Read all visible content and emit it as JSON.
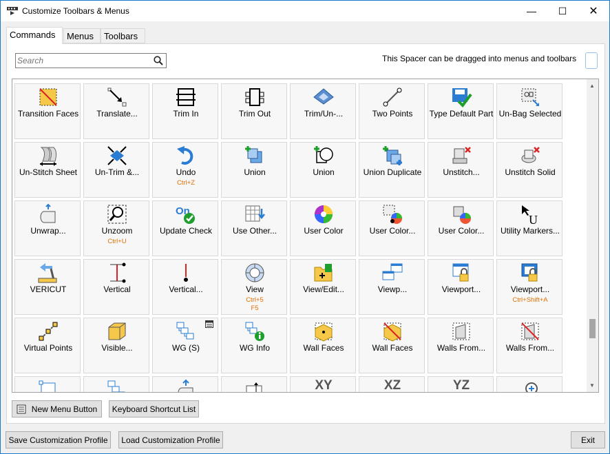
{
  "window": {
    "title": "Customize Toolbars & Menus"
  },
  "tabs": [
    "Commands",
    "Menus",
    "Toolbars"
  ],
  "search": {
    "placeholder": "Search"
  },
  "spacer": {
    "text": "This Spacer can be dragged into menus and toolbars"
  },
  "rows": [
    [
      {
        "label": "Transition Faces",
        "shortcut": "",
        "icon": "transition-faces"
      },
      {
        "label": "Translate...",
        "shortcut": "",
        "icon": "translate"
      },
      {
        "label": "Trim In",
        "shortcut": "",
        "icon": "trim-in"
      },
      {
        "label": "Trim Out",
        "shortcut": "",
        "icon": "trim-out"
      },
      {
        "label": "Trim/Un-...",
        "shortcut": "",
        "icon": "trim-untrim"
      },
      {
        "label": "Two Points",
        "shortcut": "",
        "icon": "two-points"
      },
      {
        "label": "Type Default Part",
        "shortcut": "",
        "icon": "type-default-part"
      },
      {
        "label": "Un-Bag Selected",
        "shortcut": "",
        "icon": "un-bag"
      }
    ],
    [
      {
        "label": "Un-Stitch Sheet",
        "shortcut": "",
        "icon": "unstitch-sheet"
      },
      {
        "label": "Un-Trim &...",
        "shortcut": "",
        "icon": "untrim"
      },
      {
        "label": "Undo",
        "shortcut": "Ctrl+Z",
        "icon": "undo"
      },
      {
        "label": "Union",
        "shortcut": "",
        "icon": "union-box"
      },
      {
        "label": "Union",
        "shortcut": "",
        "icon": "union-2d"
      },
      {
        "label": "Union Duplicate",
        "shortcut": "",
        "icon": "union-duplicate"
      },
      {
        "label": "Unstitch...",
        "shortcut": "",
        "icon": "unstitch"
      },
      {
        "label": "Unstitch Solid",
        "shortcut": "",
        "icon": "unstitch-solid"
      }
    ],
    [
      {
        "label": "Unwrap...",
        "shortcut": "",
        "icon": "unwrap"
      },
      {
        "label": "Unzoom",
        "shortcut": "Ctrl+U",
        "icon": "unzoom"
      },
      {
        "label": "Update Check",
        "shortcut": "",
        "icon": "update-check"
      },
      {
        "label": "Use Other...",
        "shortcut": "",
        "icon": "use-other"
      },
      {
        "label": "User Color",
        "shortcut": "",
        "icon": "user-color"
      },
      {
        "label": "User Color...",
        "shortcut": "",
        "icon": "user-color-sel"
      },
      {
        "label": "User Color...",
        "shortcut": "",
        "icon": "user-color-solid"
      },
      {
        "label": "Utility Markers...",
        "shortcut": "",
        "icon": "utility-markers"
      }
    ],
    [
      {
        "label": "VERICUT",
        "shortcut": "",
        "icon": "vericut"
      },
      {
        "label": "Vertical",
        "shortcut": "",
        "icon": "vertical"
      },
      {
        "label": "Vertical...",
        "shortcut": "",
        "icon": "vertical-line"
      },
      {
        "label": "View",
        "shortcut": "Ctrl+5",
        "shortcut2": "F5",
        "icon": "view"
      },
      {
        "label": "View/Edit...",
        "shortcut": "",
        "icon": "view-edit"
      },
      {
        "label": "Viewp...",
        "shortcut": "",
        "icon": "viewports"
      },
      {
        "label": "Viewport...",
        "shortcut": "",
        "icon": "viewport-lock"
      },
      {
        "label": "Viewport...",
        "shortcut": "Ctrl+Shift+A",
        "icon": "viewport-lock-blue"
      }
    ],
    [
      {
        "label": "Virtual Points",
        "shortcut": "",
        "icon": "virtual-points"
      },
      {
        "label": "Visible...",
        "shortcut": "",
        "icon": "visible"
      },
      {
        "label": "WG (S)",
        "shortcut": "",
        "icon": "wg",
        "badge": true
      },
      {
        "label": "WG Info",
        "shortcut": "",
        "icon": "wg-info"
      },
      {
        "label": "Wall Faces",
        "shortcut": "",
        "icon": "wall-faces"
      },
      {
        "label": "Wall Faces",
        "shortcut": "",
        "icon": "wall-faces-x"
      },
      {
        "label": "Walls From...",
        "shortcut": "",
        "icon": "walls-from"
      },
      {
        "label": "Walls From...",
        "shortcut": "",
        "icon": "walls-from-x"
      }
    ],
    [
      {
        "label": "",
        "shortcut": "",
        "icon": "row6-a"
      },
      {
        "label": "",
        "shortcut": "",
        "icon": "row6-b"
      },
      {
        "label": "",
        "shortcut": "",
        "icon": "row6-c"
      },
      {
        "label": "",
        "shortcut": "",
        "icon": "row6-d"
      },
      {
        "label": "",
        "shortcut": "",
        "icon": "xy",
        "bigtext": "XY"
      },
      {
        "label": "",
        "shortcut": "",
        "icon": "xz",
        "bigtext": "XZ"
      },
      {
        "label": "",
        "shortcut": "",
        "icon": "yz",
        "bigtext": "YZ"
      },
      {
        "label": "",
        "shortcut": "",
        "icon": "zoom-in"
      }
    ]
  ],
  "buttons": {
    "new_menu": "New Menu Button",
    "shortcut_list": "Keyboard Shortcut List",
    "save_profile": "Save Customization Profile",
    "load_profile": "Load Customization Profile",
    "exit": "Exit"
  },
  "colors": {
    "accent": "#1979ca",
    "shortcut": "#e07000"
  }
}
